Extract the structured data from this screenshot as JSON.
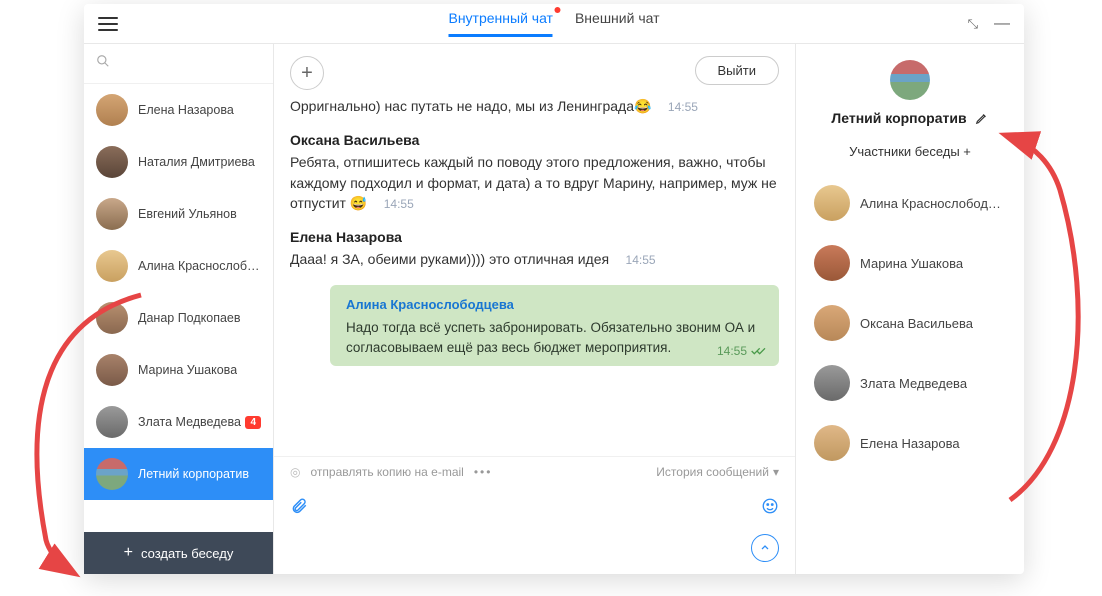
{
  "tabs": {
    "internal": "Внутренный чат",
    "external": "Внешний чат"
  },
  "sidebar": {
    "contacts": [
      {
        "name": "Елена Назарова"
      },
      {
        "name": "Наталия Дмитриева"
      },
      {
        "name": "Евгений Ульянов"
      },
      {
        "name": "Алина Краснослобод.."
      },
      {
        "name": "Данар Подкопаев"
      },
      {
        "name": "Марина Ушакова"
      },
      {
        "name": "Злата Медведева",
        "badge": "4"
      },
      {
        "name": "Летний корпоратив"
      }
    ],
    "create": "создать беседу"
  },
  "main": {
    "exit": "Выйти",
    "m0": {
      "text": "Орригнально) нас путать не надо, мы из Ленинграда😂",
      "time": "14:55"
    },
    "m1": {
      "author": "Оксана Васильева",
      "text": "Ребята, отпишитесь каждый по поводу этого предложения, важно, чтобы каждому подходил и формат, и дата) а то вдруг Марину, например, муж не отпустит 😅",
      "time": "14:55"
    },
    "m2": {
      "author": "Елена Назарова",
      "text": "Дааа! я ЗА, обеими руками)))) это отличная идея",
      "time": "14:55"
    },
    "m3": {
      "author": "Алина Краснослободцева",
      "text": "Надо тогда всё успеть забронировать. Обязательно звоним ОА и согласовываем ещё раз весь бюджет мероприятия.",
      "time": "14:55"
    },
    "email_copy": "отправлять копию на e-mail",
    "history": "История сообщений"
  },
  "right": {
    "title": "Летний корпоратив",
    "subtitle": "Участники беседы +",
    "members": [
      {
        "name": "Алина Краснослободцева"
      },
      {
        "name": "Марина Ушакова"
      },
      {
        "name": "Оксана Васильева"
      },
      {
        "name": "Злата Медведева"
      },
      {
        "name": "Елена Назарова"
      }
    ]
  }
}
